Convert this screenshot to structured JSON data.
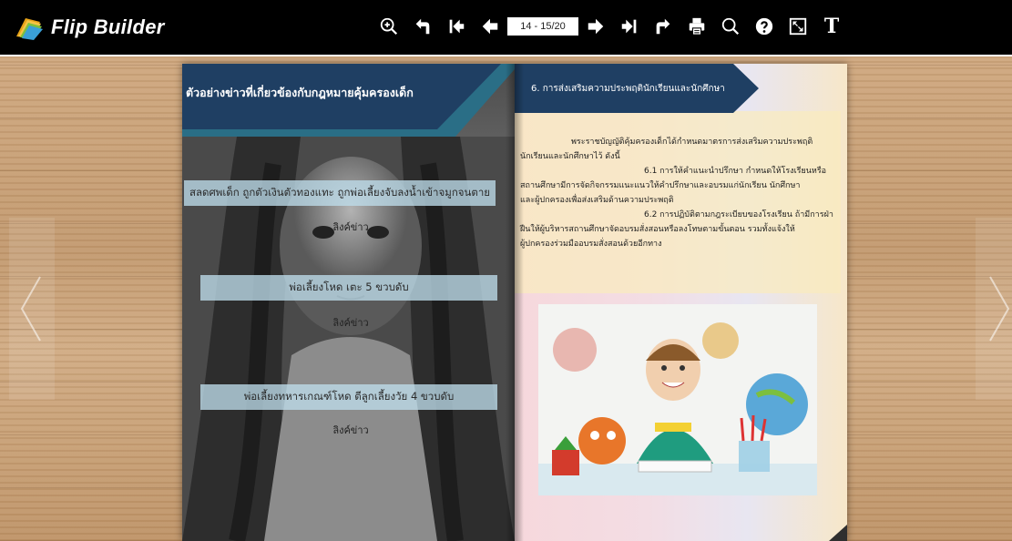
{
  "app": {
    "brand": "Flip Builder"
  },
  "toolbar": {
    "icons": [
      "zoom-in-icon",
      "undo-icon",
      "first-page-icon",
      "prev-page-icon",
      "next-page-icon",
      "last-page-icon",
      "redo-icon",
      "print-icon",
      "search-icon",
      "help-icon",
      "fullscreen-icon",
      "text-icon"
    ],
    "page_indicator": "14 - 15/20",
    "text_label": "T"
  },
  "left_page": {
    "banner_title": "ตัวอย่างข่าวที่เกี่ยวข้องกับกฎหมายคุ้มครองเด็ก",
    "news": [
      {
        "headline": "สลดศพเด็ก ถูกตัวเงินตัวทองแทะ ถูกพ่อเลี้ยงจับลงน้ำเข้าจมูกจนตาย",
        "link": "ลิงค์ข่าว"
      },
      {
        "headline": "พ่อเลี้ยงโหด เตะ 5 ขวบดับ",
        "link": "ลิงค์ข่าว"
      },
      {
        "headline": "พ่อเลี้ยงทหารเกณฑ์โหด ตีลูกเลี้ยงวัย 4 ขวบดับ",
        "link": "ลิงค์ข่าว"
      }
    ]
  },
  "right_page": {
    "banner_title": "6. การส่งเสริมความประพฤตินักเรียนและนักศึกษา",
    "paragraphs": [
      "พระราชบัญญัติคุ้มครองเด็กได้กำหนดมาตรการส่งเสริมความประพฤติ",
      "นักเรียนและนักศึกษาไว้ ดังนี้",
      "6.1 การให้คำแนะนำปรึกษา กำหนดให้โรงเรียนหรือ",
      "สถานศึกษามีการจัดกิจกรรมแนะแนวให้คำปรึกษาและอบรมแก่นักเรียน นักศึกษา",
      "และผู้ปกครองเพื่อส่งเสริมด้านความประพฤติ",
      "6.2 การปฏิบัติตามกฎระเบียบของโรงเรียน ถ้ามีการฝ่า",
      "ฝืนให้ผู้บริหารสถานศึกษาจัดอบรมสั่งสอนหรือลงโทษตามขั้นตอน รวมทั้งแจ้งให้",
      "ผู้ปกครองร่วมมืออบรมสั่งสอนด้วยอีกทาง"
    ]
  },
  "colors": {
    "toolbar_bg": "#000000",
    "banner_navy": "#1f3f63",
    "banner_teal": "#2a6e86",
    "news_box": "#bedceb"
  }
}
